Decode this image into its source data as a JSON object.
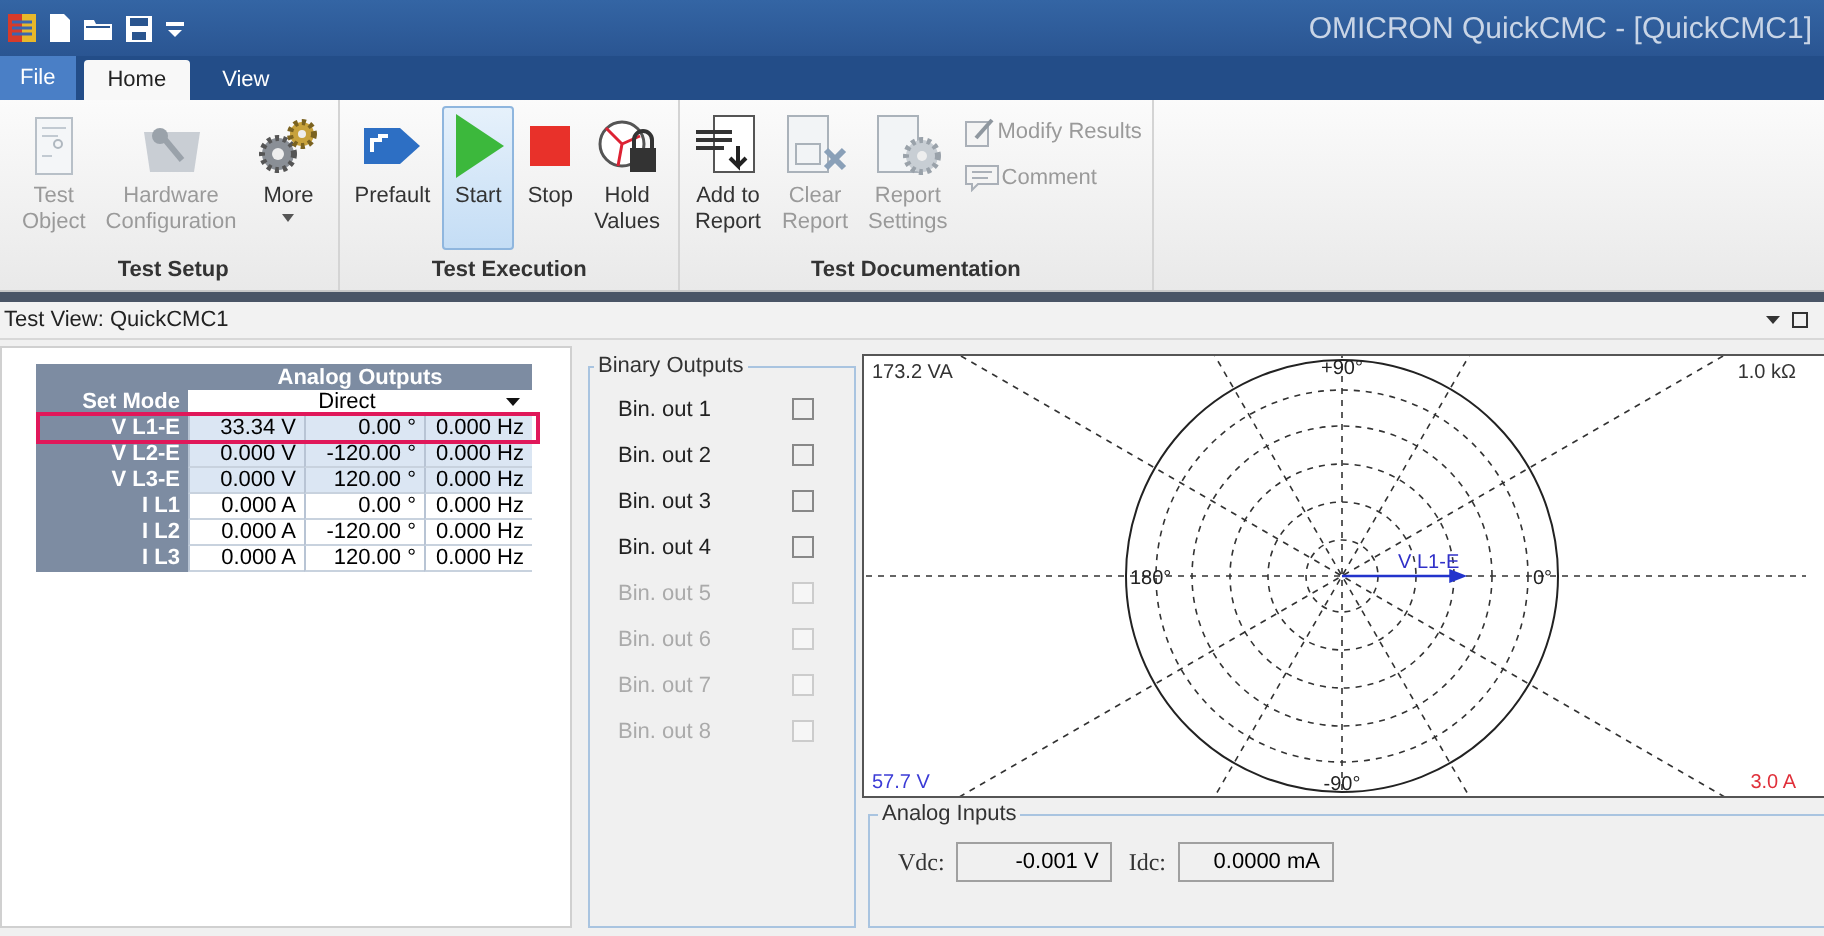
{
  "window": {
    "title": "OMICRON QuickCMC - [QuickCMC1]"
  },
  "file_button": {
    "label": "File"
  },
  "ribbon_tabs": [
    {
      "label": "Home",
      "selected": true
    },
    {
      "label": "View",
      "selected": false
    }
  ],
  "ribbon_groups": [
    {
      "label": "Test Setup",
      "buttons": [
        {
          "label": "Test\nObject",
          "kind": "large",
          "disabled": true,
          "pressed": false,
          "dropdown": false
        },
        {
          "label": "Hardware\nConfiguration",
          "kind": "large",
          "disabled": true,
          "pressed": false,
          "dropdown": false
        },
        {
          "label": "More",
          "kind": "large",
          "disabled": false,
          "pressed": false,
          "dropdown": true
        }
      ]
    },
    {
      "label": "Test Execution",
      "buttons": [
        {
          "label": "Prefault",
          "kind": "large",
          "disabled": false,
          "pressed": false,
          "dropdown": false
        },
        {
          "label": "Start",
          "kind": "large",
          "disabled": false,
          "pressed": true,
          "dropdown": false
        },
        {
          "label": "Stop",
          "kind": "large",
          "disabled": false,
          "pressed": false,
          "dropdown": false
        },
        {
          "label": "Hold\nValues",
          "kind": "large",
          "disabled": false,
          "pressed": false,
          "dropdown": false
        }
      ]
    },
    {
      "label": "Test Documentation",
      "buttons": [
        {
          "label": "Add to\nReport",
          "kind": "large",
          "disabled": false,
          "pressed": false,
          "dropdown": false
        },
        {
          "label": "Clear\nReport",
          "kind": "large",
          "disabled": true,
          "pressed": false,
          "dropdown": false
        },
        {
          "label": "Report\nSettings",
          "kind": "large",
          "disabled": true,
          "pressed": false,
          "dropdown": false
        },
        {
          "label": "Modify Results",
          "kind": "small",
          "disabled": true,
          "pressed": false,
          "dropdown": false
        },
        {
          "label": "Comment",
          "kind": "small",
          "disabled": true,
          "pressed": false,
          "dropdown": false
        }
      ]
    }
  ],
  "test_view": {
    "title": "Test View: QuickCMC1"
  },
  "analog_outputs": {
    "title": "Analog Outputs",
    "set_mode": {
      "label": "Set Mode",
      "value": "Direct"
    },
    "rows": [
      {
        "label": "V L1-E",
        "magnitude": "33.34 V",
        "angle": "0.00 °",
        "frequency": "0.000 Hz",
        "kind": "voltage",
        "outlined": true
      },
      {
        "label": "V L2-E",
        "magnitude": "0.000 V",
        "angle": "-120.00 °",
        "frequency": "0.000 Hz",
        "kind": "voltage",
        "outlined": false
      },
      {
        "label": "V L3-E",
        "magnitude": "0.000 V",
        "angle": "120.00 °",
        "frequency": "0.000 Hz",
        "kind": "voltage",
        "outlined": false
      },
      {
        "label": "I L1",
        "magnitude": "0.000 A",
        "angle": "0.00 °",
        "frequency": "0.000 Hz",
        "kind": "current",
        "outlined": false
      },
      {
        "label": "I L2",
        "magnitude": "0.000 A",
        "angle": "-120.00 °",
        "frequency": "0.000 Hz",
        "kind": "current",
        "outlined": false
      },
      {
        "label": "I L3",
        "magnitude": "0.000 A",
        "angle": "120.00 °",
        "frequency": "0.000 Hz",
        "kind": "current",
        "outlined": false
      }
    ]
  },
  "binary_outputs": {
    "title": "Binary Outputs",
    "items": [
      {
        "label": "Bin. out 1",
        "checked": false,
        "disabled": false
      },
      {
        "label": "Bin. out 2",
        "checked": false,
        "disabled": false
      },
      {
        "label": "Bin. out 3",
        "checked": false,
        "disabled": false
      },
      {
        "label": "Bin. out 4",
        "checked": false,
        "disabled": false
      },
      {
        "label": "Bin. out 5",
        "checked": false,
        "disabled": true
      },
      {
        "label": "Bin. out 6",
        "checked": false,
        "disabled": true
      },
      {
        "label": "Bin. out 7",
        "checked": false,
        "disabled": true
      },
      {
        "label": "Bin. out 8",
        "checked": false,
        "disabled": true
      }
    ]
  },
  "phasor_diagram": {
    "scales": [
      {
        "text": "173.2 VA",
        "color": "#333333"
      },
      {
        "text": "1.0 kΩ",
        "color": "#333333"
      },
      {
        "text": "57.7 V",
        "color": "#3b3bd6"
      },
      {
        "text": "3.0 A",
        "color": "#e0303a"
      }
    ],
    "angle_labels": [
      "+90°",
      "180°",
      "0°",
      "-90°"
    ],
    "vector": {
      "label": "V L1-E",
      "level": 0.58
    }
  },
  "analog_inputs": {
    "title": "Analog Inputs",
    "fields": [
      {
        "label": "Vdc:",
        "value": "-0.001 V"
      },
      {
        "label": "Idc:",
        "value": "0.0000 mA"
      }
    ]
  }
}
